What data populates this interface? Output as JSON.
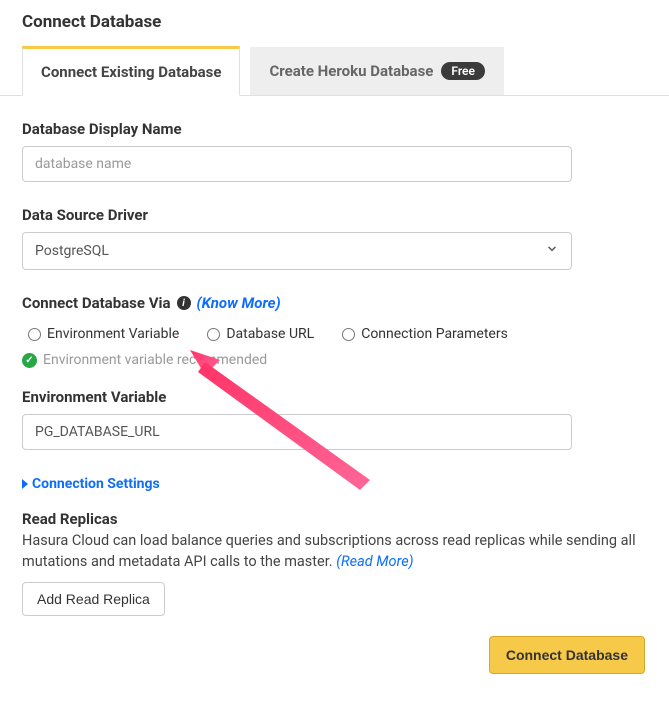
{
  "page": {
    "title": "Connect Database"
  },
  "tabs": {
    "existing": "Connect Existing Database",
    "heroku": "Create Heroku Database",
    "heroku_badge": "Free"
  },
  "form": {
    "display_name_label": "Database Display Name",
    "display_name_placeholder": "database name",
    "driver_label": "Data Source Driver",
    "driver_value": "PostgreSQL",
    "connect_via_label": "Connect Database Via",
    "know_more": "(Know More)",
    "radio": {
      "env": "Environment Variable",
      "url": "Database URL",
      "params": "Connection Parameters"
    },
    "recommended_text": "Environment variable recommended",
    "env_var_label": "Environment Variable",
    "env_var_value": "PG_DATABASE_URL"
  },
  "connection_settings": "Connection Settings",
  "replicas": {
    "title": "Read Replicas",
    "desc": "Hasura Cloud can load balance queries and subscriptions across read replicas while sending all mutations and metadata API calls to the master. ",
    "read_more": "(Read More)",
    "add_btn": "Add Read Replica"
  },
  "footer": {
    "connect_btn": "Connect Database"
  }
}
